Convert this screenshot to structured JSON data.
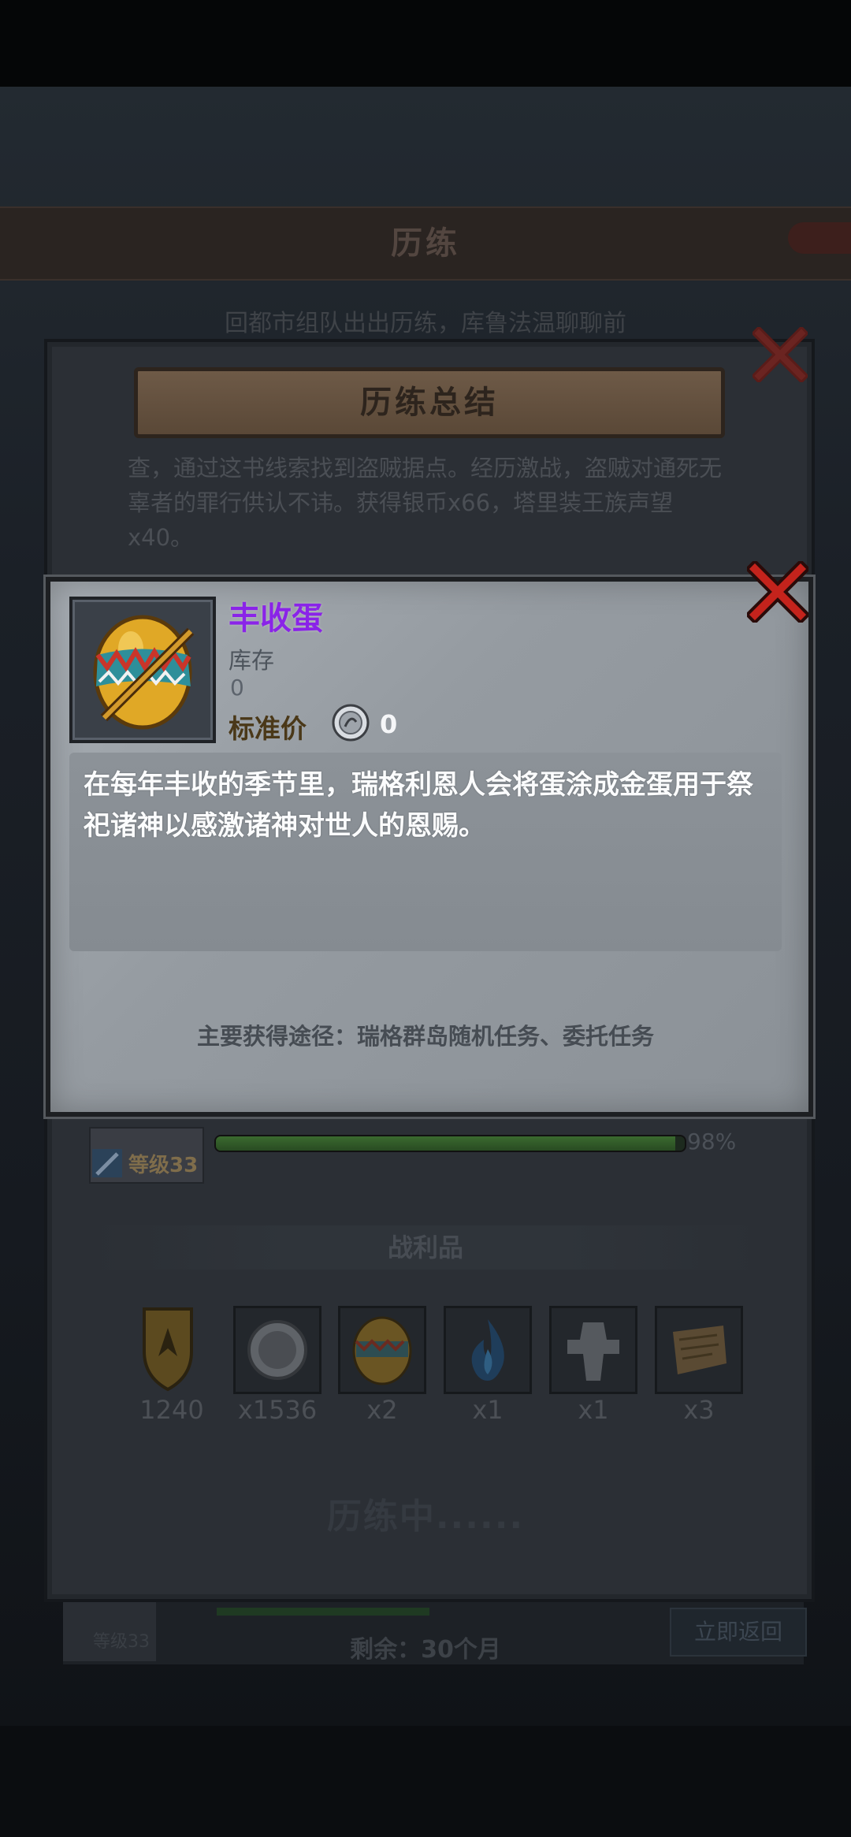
{
  "underlying": {
    "title": "历练",
    "subtitle": "回都市组队出出历练，库鲁法温聊聊前",
    "remaining": "剩余：30个月",
    "return_button": "立即返回",
    "level": "等级33"
  },
  "summary": {
    "banner": "历练总结",
    "text": "查，通过这书线索找到盗贼据点。经历激战，盗贼对通死无辜者的罪行供认不讳。获得银币x66，塔里装王族声望x40。",
    "hero_level": "等级33",
    "xp_percent_label": "98%",
    "xp_fraction": 0.98,
    "loot_header": "战利品",
    "loot": [
      {
        "icon": "crest-shield-icon",
        "count": "1240"
      },
      {
        "icon": "silver-coin-icon",
        "count": "x1536"
      },
      {
        "icon": "harvest-egg-icon",
        "count": "x2"
      },
      {
        "icon": "blue-flame-icon",
        "count": "x1"
      },
      {
        "icon": "stone-relic-icon",
        "count": "x1"
      },
      {
        "icon": "scroll-icon",
        "count": "x3"
      }
    ],
    "status": "历练中......"
  },
  "item": {
    "name": "丰收蛋",
    "name_color": "#8a23e8",
    "stock_label": "库存",
    "stock_value": "0",
    "price_label": "标准价",
    "price_value": "0",
    "description": "在每年丰收的季节里，瑞格利恩人会将蛋涂成金蛋用于祭祀诸神以感激诸神对世人的恩赐。",
    "source": "主要获得途径：瑞格群岛随机任务、委托任务"
  }
}
